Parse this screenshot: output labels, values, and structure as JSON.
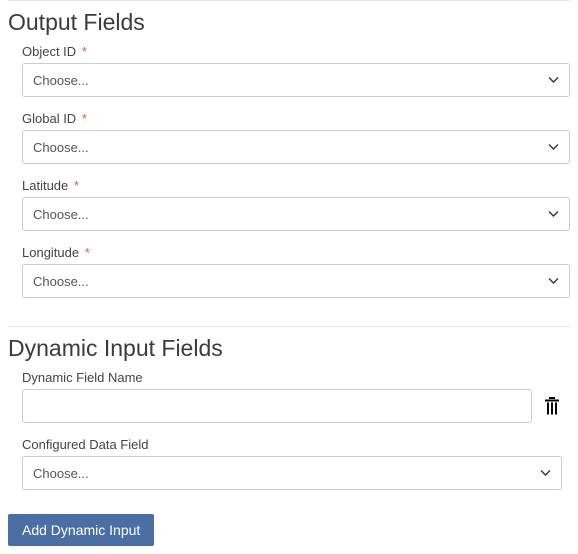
{
  "output_fields": {
    "title": "Output Fields",
    "fields": [
      {
        "label": "Object ID",
        "required": "*",
        "value": "Choose..."
      },
      {
        "label": "Global ID",
        "required": "*",
        "value": "Choose..."
      },
      {
        "label": "Latitude",
        "required": "*",
        "value": "Choose..."
      },
      {
        "label": "Longitude",
        "required": "*",
        "value": "Choose..."
      }
    ]
  },
  "dynamic_input": {
    "title": "Dynamic Input Fields",
    "name_label": "Dynamic Field Name",
    "name_value": "",
    "configured_label": "Configured Data Field",
    "configured_value": "Choose...",
    "add_button": "Add Dynamic Input"
  }
}
